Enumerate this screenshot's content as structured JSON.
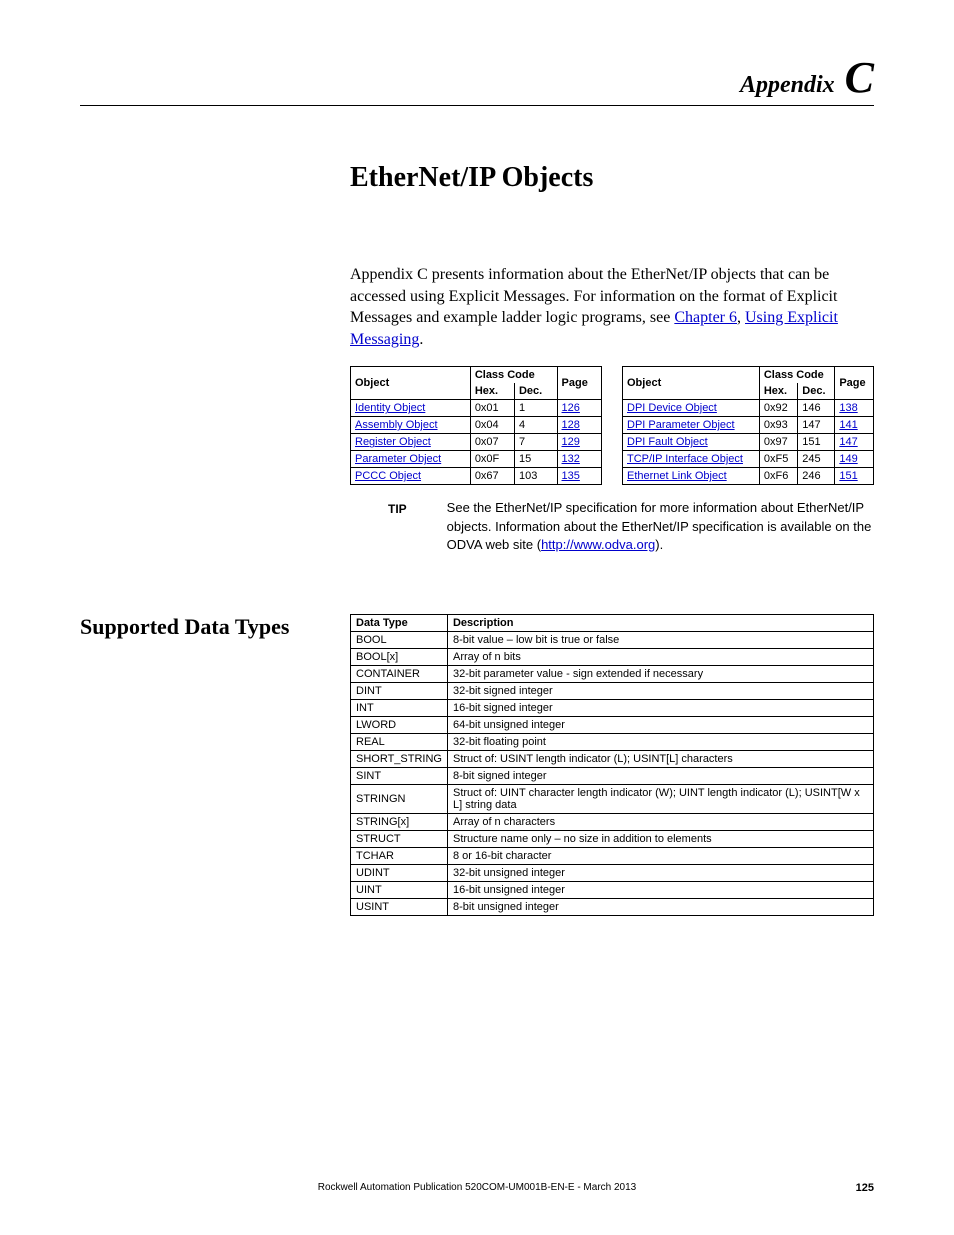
{
  "header": {
    "appendix_word": "Appendix",
    "appendix_letter": "C"
  },
  "chapter_title": "EtherNet/IP Objects",
  "intro": {
    "text_before_links": "Appendix C presents information about the EtherNet/IP objects that can be accessed using Explicit Messages. For information on the format of Explicit Messages and example ladder logic programs, see ",
    "link1": "Chapter 6",
    "comma": ", ",
    "link2": "Using Explicit Messaging",
    "period": "."
  },
  "obj_headers": {
    "object": "Object",
    "class_code": "Class Code",
    "page": "Page",
    "hex": "Hex.",
    "dec": "Dec."
  },
  "left_objects": [
    {
      "name": "Identity Object",
      "hex": "0x01",
      "dec": "1",
      "page": "126"
    },
    {
      "name": "Assembly Object",
      "hex": "0x04",
      "dec": "4",
      "page": "128"
    },
    {
      "name": "Register Object",
      "hex": "0x07",
      "dec": "7",
      "page": "129"
    },
    {
      "name": "Parameter Object",
      "hex": "0x0F",
      "dec": "15",
      "page": "132"
    },
    {
      "name": "PCCC Object",
      "hex": "0x67",
      "dec": "103",
      "page": "135"
    }
  ],
  "right_objects": [
    {
      "name": "DPI Device Object",
      "hex": "0x92",
      "dec": "146",
      "page": "138"
    },
    {
      "name": "DPI Parameter Object",
      "hex": "0x93",
      "dec": "147",
      "page": "141"
    },
    {
      "name": "DPI Fault Object",
      "hex": "0x97",
      "dec": "151",
      "page": "147"
    },
    {
      "name": "TCP/IP Interface Object",
      "hex": "0xF5",
      "dec": "245",
      "page": "149"
    },
    {
      "name": "Ethernet Link Object",
      "hex": "0xF6",
      "dec": "246",
      "page": "151"
    }
  ],
  "tip": {
    "label": "TIP",
    "text_before": "See the EtherNet/IP specification for more information about EtherNet/IP objects. Information about the EtherNet/IP specification is available on the ODVA web site (",
    "link": "http://www.odva.org",
    "text_after": ")."
  },
  "section_heading": "Supported Data Types",
  "dt_headers": {
    "type": "Data Type",
    "desc": "Description"
  },
  "data_types": [
    {
      "t": "BOOL",
      "d": "8-bit value – low bit is true or false"
    },
    {
      "t": "BOOL[x]",
      "d": "Array of n bits"
    },
    {
      "t": "CONTAINER",
      "d": "32-bit parameter value - sign extended if necessary"
    },
    {
      "t": "DINT",
      "d": "32-bit signed integer"
    },
    {
      "t": "INT",
      "d": "16-bit signed integer"
    },
    {
      "t": "LWORD",
      "d": "64-bit unsigned integer"
    },
    {
      "t": "REAL",
      "d": "32-bit floating point"
    },
    {
      "t": "SHORT_STRING",
      "d": "Struct of: USINT length indicator (L); USINT[L] characters"
    },
    {
      "t": "SINT",
      "d": "8-bit signed integer"
    },
    {
      "t": "STRINGN",
      "d": "Struct of: UINT character length indicator (W); UINT length indicator (L); USINT[W x L] string data"
    },
    {
      "t": "STRING[x]",
      "d": "Array of n characters"
    },
    {
      "t": "STRUCT",
      "d": "Structure name only – no size in addition to elements"
    },
    {
      "t": "TCHAR",
      "d": "8 or 16-bit character"
    },
    {
      "t": "UDINT",
      "d": "32-bit unsigned integer"
    },
    {
      "t": "UINT",
      "d": "16-bit unsigned integer"
    },
    {
      "t": "USINT",
      "d": "8-bit unsigned integer"
    }
  ],
  "footer": {
    "pub": "Rockwell Automation Publication 520COM-UM001B-EN-E - March 2013",
    "page": "125"
  }
}
